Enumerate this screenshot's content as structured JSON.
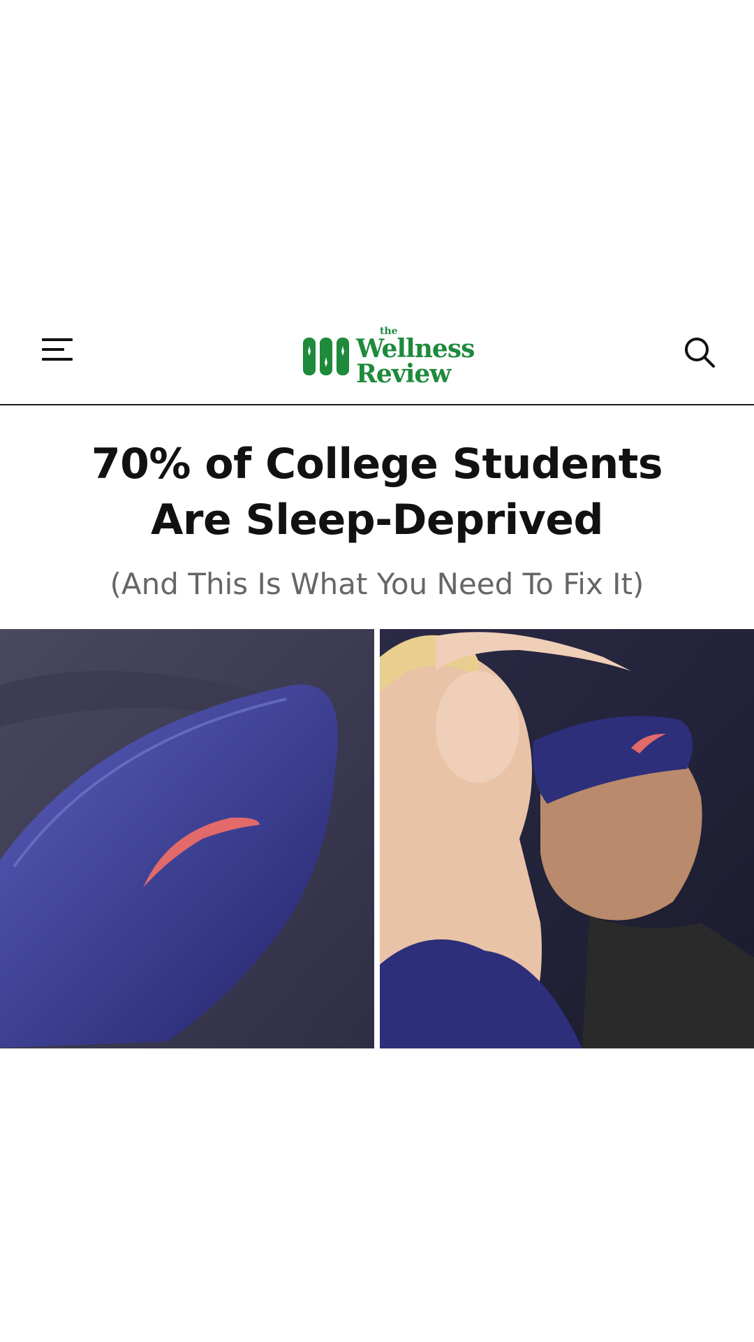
{
  "header": {
    "logo_the": "the",
    "logo_line1": "Wellness",
    "logo_line2": "Review",
    "menu_icon": "hamburger-menu-icon",
    "search_icon": "search-icon"
  },
  "article": {
    "headline_line1": "70% of College Students",
    "headline_line2": "Are Sleep-Deprived",
    "subheadline": "(And This Is What You Need To Fix It)"
  },
  "colors": {
    "brand_green": "#1e8a3c",
    "mask_navy": "#2d2f7a",
    "mask_accent": "#e26a6a"
  }
}
